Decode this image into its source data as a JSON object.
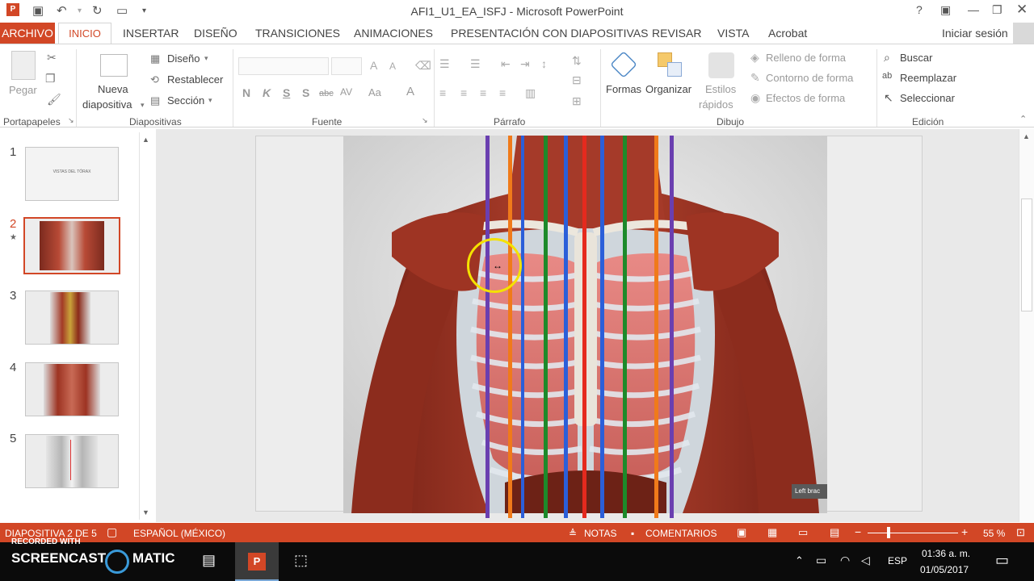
{
  "app": {
    "title": "AFI1_U1_EA_ISFJ - Microsoft PowerPoint",
    "help": "?",
    "signin": "Iniciar sesión"
  },
  "tabs": {
    "archivo": "ARCHIVO",
    "items": [
      "INICIO",
      "INSERTAR",
      "DISEÑO",
      "TRANSICIONES",
      "ANIMACIONES",
      "PRESENTACIÓN CON DIAPOSITIVAS",
      "REVISAR",
      "VISTA",
      "Acrobat"
    ]
  },
  "ribbon": {
    "portapapeles": {
      "label": "Portapapeles",
      "pegar": "Pegar"
    },
    "diapositivas": {
      "label": "Diapositivas",
      "nueva1": "Nueva",
      "nueva2": "diapositiva",
      "diseno": "Diseño",
      "restablecer": "Restablecer",
      "seccion": "Sección"
    },
    "fuente": {
      "label": "Fuente",
      "bold": "N",
      "italic": "K",
      "underline": "S",
      "shadow": "S",
      "strike": "abc",
      "spacing": "AV",
      "case": "Aa",
      "color": "A"
    },
    "parrafo": {
      "label": "Párrafo"
    },
    "dibujo": {
      "label": "Dibujo",
      "formas": "Formas",
      "organizar": "Organizar",
      "estilos1": "Estilos",
      "estilos2": "rápidos",
      "relleno": "Relleno de forma",
      "contorno": "Contorno de forma",
      "efectos": "Efectos de forma"
    },
    "edicion": {
      "label": "Edición",
      "buscar": "Buscar",
      "reemplazar": "Reemplazar",
      "seleccionar": "Seleccionar"
    }
  },
  "slides": [
    {
      "num": "1",
      "text": "VISTAS DEL TÓRAX"
    },
    {
      "num": "2",
      "star": "★"
    },
    {
      "num": "3"
    },
    {
      "num": "4"
    },
    {
      "num": "5"
    }
  ],
  "slide_image": {
    "label": "Left brac"
  },
  "status": {
    "slide": "DIAPOSITIVA 2 DE 5",
    "language": "ESPAÑOL (MÉXICO)",
    "notas": "NOTAS",
    "comentarios": "COMENTARIOS",
    "zoom": "55 %"
  },
  "watermark": {
    "recorded": "RECORDED WITH",
    "brand_a": "SCREENCAST",
    "brand_b": "MATIC"
  },
  "taskbar": {
    "lang": "ESP",
    "time": "01:36 a. m.",
    "date": "01/05/2017"
  },
  "colors": {
    "accent": "#d24726",
    "purple": "#6a3fb0",
    "orange": "#f07a1a",
    "blue": "#2b5fd9",
    "green": "#1d8a2a",
    "red": "#e52a1e",
    "highlight": "#f4e200"
  }
}
